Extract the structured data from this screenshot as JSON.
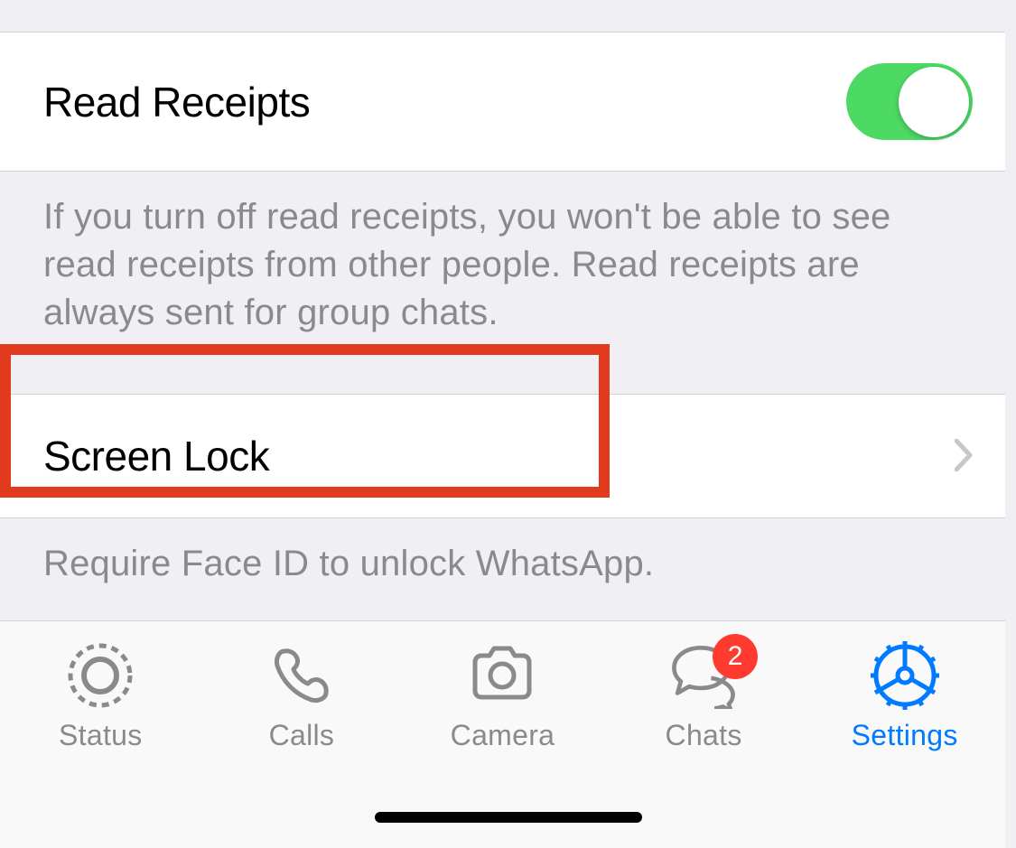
{
  "settings": {
    "readReceipts": {
      "label": "Read Receipts",
      "enabled": true,
      "description": "If you turn off read receipts, you won't be able to see read receipts from other people. Read receipts are always sent for group chats."
    },
    "screenLock": {
      "label": "Screen Lock",
      "description": "Require Face ID to unlock WhatsApp."
    }
  },
  "tabBar": {
    "items": [
      {
        "label": "Status",
        "icon": "status-icon",
        "active": false
      },
      {
        "label": "Calls",
        "icon": "phone-icon",
        "active": false
      },
      {
        "label": "Camera",
        "icon": "camera-icon",
        "active": false
      },
      {
        "label": "Chats",
        "icon": "chat-icon",
        "active": false,
        "badge": "2"
      },
      {
        "label": "Settings",
        "icon": "gear-icon",
        "active": true
      }
    ]
  }
}
